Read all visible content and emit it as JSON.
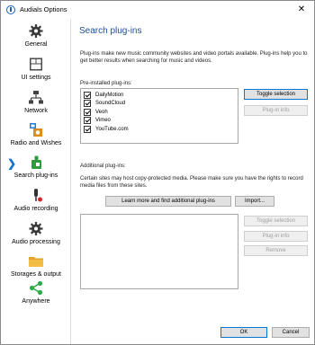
{
  "window": {
    "title": "Audials Options",
    "close_symbol": "✕"
  },
  "sidebar": {
    "items": [
      {
        "label": "General",
        "icon": "gear-icon"
      },
      {
        "label": "UI settings",
        "icon": "window-layout-icon"
      },
      {
        "label": "Network",
        "icon": "network-icon"
      },
      {
        "label": "Radio and Wishes",
        "icon": "radio-wishes-icon"
      },
      {
        "label": "Search plug-ins",
        "icon": "search-plugins-icon",
        "selected": true
      },
      {
        "label": "Audio recording",
        "icon": "microphone-icon"
      },
      {
        "label": "Audio processing",
        "icon": "gear-icon"
      },
      {
        "label": "Storages & output",
        "icon": "folder-icon"
      },
      {
        "label": "Anywhere",
        "icon": "share-icon"
      }
    ]
  },
  "main": {
    "heading": "Search plug-ins",
    "description": "Plug-ins make new music community websites and video portals available. Plug-ins help you to get better results when searching for music and videos.",
    "preinstalled": {
      "label": "Pre-installed plug-ins:",
      "items": [
        {
          "name": "DailyMotion",
          "checked": true
        },
        {
          "name": "SoundCloud",
          "checked": true
        },
        {
          "name": "Veoh",
          "checked": true
        },
        {
          "name": "Vimeo",
          "checked": true
        },
        {
          "name": "YouTube.com",
          "checked": true
        }
      ],
      "toggle_label": "Toggle selection",
      "info_label": "Plug-in info"
    },
    "additional": {
      "label": "Additional plug-ins:",
      "note": "Certain sites may host copy-protected media. Please make sure you have the rights to record media files from these sites.",
      "learn_more_label": "Learn more and find additional plug-ins",
      "import_label": "Import...",
      "toggle_label": "Toggle selection",
      "info_label": "Plug-in info",
      "remove_label": "Remove"
    }
  },
  "footer": {
    "ok_label": "OK",
    "cancel_label": "Cancel"
  }
}
